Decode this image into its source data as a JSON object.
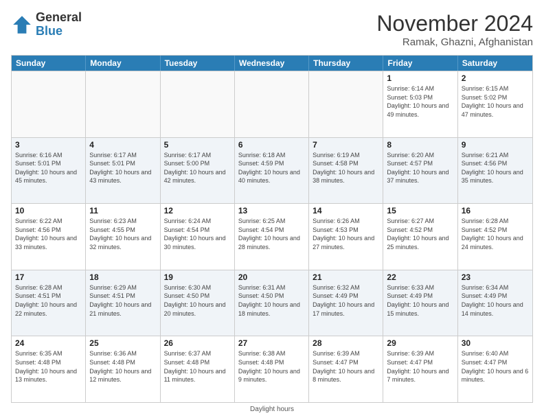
{
  "header": {
    "logo_general": "General",
    "logo_blue": "Blue",
    "main_title": "November 2024",
    "subtitle": "Ramak, Ghazni, Afghanistan"
  },
  "days_of_week": [
    "Sunday",
    "Monday",
    "Tuesday",
    "Wednesday",
    "Thursday",
    "Friday",
    "Saturday"
  ],
  "weeks": [
    [
      {
        "day": "",
        "info": ""
      },
      {
        "day": "",
        "info": ""
      },
      {
        "day": "",
        "info": ""
      },
      {
        "day": "",
        "info": ""
      },
      {
        "day": "",
        "info": ""
      },
      {
        "day": "1",
        "info": "Sunrise: 6:14 AM\nSunset: 5:03 PM\nDaylight: 10 hours and 49 minutes."
      },
      {
        "day": "2",
        "info": "Sunrise: 6:15 AM\nSunset: 5:02 PM\nDaylight: 10 hours and 47 minutes."
      }
    ],
    [
      {
        "day": "3",
        "info": "Sunrise: 6:16 AM\nSunset: 5:01 PM\nDaylight: 10 hours and 45 minutes."
      },
      {
        "day": "4",
        "info": "Sunrise: 6:17 AM\nSunset: 5:01 PM\nDaylight: 10 hours and 43 minutes."
      },
      {
        "day": "5",
        "info": "Sunrise: 6:17 AM\nSunset: 5:00 PM\nDaylight: 10 hours and 42 minutes."
      },
      {
        "day": "6",
        "info": "Sunrise: 6:18 AM\nSunset: 4:59 PM\nDaylight: 10 hours and 40 minutes."
      },
      {
        "day": "7",
        "info": "Sunrise: 6:19 AM\nSunset: 4:58 PM\nDaylight: 10 hours and 38 minutes."
      },
      {
        "day": "8",
        "info": "Sunrise: 6:20 AM\nSunset: 4:57 PM\nDaylight: 10 hours and 37 minutes."
      },
      {
        "day": "9",
        "info": "Sunrise: 6:21 AM\nSunset: 4:56 PM\nDaylight: 10 hours and 35 minutes."
      }
    ],
    [
      {
        "day": "10",
        "info": "Sunrise: 6:22 AM\nSunset: 4:56 PM\nDaylight: 10 hours and 33 minutes."
      },
      {
        "day": "11",
        "info": "Sunrise: 6:23 AM\nSunset: 4:55 PM\nDaylight: 10 hours and 32 minutes."
      },
      {
        "day": "12",
        "info": "Sunrise: 6:24 AM\nSunset: 4:54 PM\nDaylight: 10 hours and 30 minutes."
      },
      {
        "day": "13",
        "info": "Sunrise: 6:25 AM\nSunset: 4:54 PM\nDaylight: 10 hours and 28 minutes."
      },
      {
        "day": "14",
        "info": "Sunrise: 6:26 AM\nSunset: 4:53 PM\nDaylight: 10 hours and 27 minutes."
      },
      {
        "day": "15",
        "info": "Sunrise: 6:27 AM\nSunset: 4:52 PM\nDaylight: 10 hours and 25 minutes."
      },
      {
        "day": "16",
        "info": "Sunrise: 6:28 AM\nSunset: 4:52 PM\nDaylight: 10 hours and 24 minutes."
      }
    ],
    [
      {
        "day": "17",
        "info": "Sunrise: 6:28 AM\nSunset: 4:51 PM\nDaylight: 10 hours and 22 minutes."
      },
      {
        "day": "18",
        "info": "Sunrise: 6:29 AM\nSunset: 4:51 PM\nDaylight: 10 hours and 21 minutes."
      },
      {
        "day": "19",
        "info": "Sunrise: 6:30 AM\nSunset: 4:50 PM\nDaylight: 10 hours and 20 minutes."
      },
      {
        "day": "20",
        "info": "Sunrise: 6:31 AM\nSunset: 4:50 PM\nDaylight: 10 hours and 18 minutes."
      },
      {
        "day": "21",
        "info": "Sunrise: 6:32 AM\nSunset: 4:49 PM\nDaylight: 10 hours and 17 minutes."
      },
      {
        "day": "22",
        "info": "Sunrise: 6:33 AM\nSunset: 4:49 PM\nDaylight: 10 hours and 15 minutes."
      },
      {
        "day": "23",
        "info": "Sunrise: 6:34 AM\nSunset: 4:49 PM\nDaylight: 10 hours and 14 minutes."
      }
    ],
    [
      {
        "day": "24",
        "info": "Sunrise: 6:35 AM\nSunset: 4:48 PM\nDaylight: 10 hours and 13 minutes."
      },
      {
        "day": "25",
        "info": "Sunrise: 6:36 AM\nSunset: 4:48 PM\nDaylight: 10 hours and 12 minutes."
      },
      {
        "day": "26",
        "info": "Sunrise: 6:37 AM\nSunset: 4:48 PM\nDaylight: 10 hours and 11 minutes."
      },
      {
        "day": "27",
        "info": "Sunrise: 6:38 AM\nSunset: 4:48 PM\nDaylight: 10 hours and 9 minutes."
      },
      {
        "day": "28",
        "info": "Sunrise: 6:39 AM\nSunset: 4:47 PM\nDaylight: 10 hours and 8 minutes."
      },
      {
        "day": "29",
        "info": "Sunrise: 6:39 AM\nSunset: 4:47 PM\nDaylight: 10 hours and 7 minutes."
      },
      {
        "day": "30",
        "info": "Sunrise: 6:40 AM\nSunset: 4:47 PM\nDaylight: 10 hours and 6 minutes."
      }
    ]
  ],
  "footer": {
    "text": "Daylight hours"
  }
}
